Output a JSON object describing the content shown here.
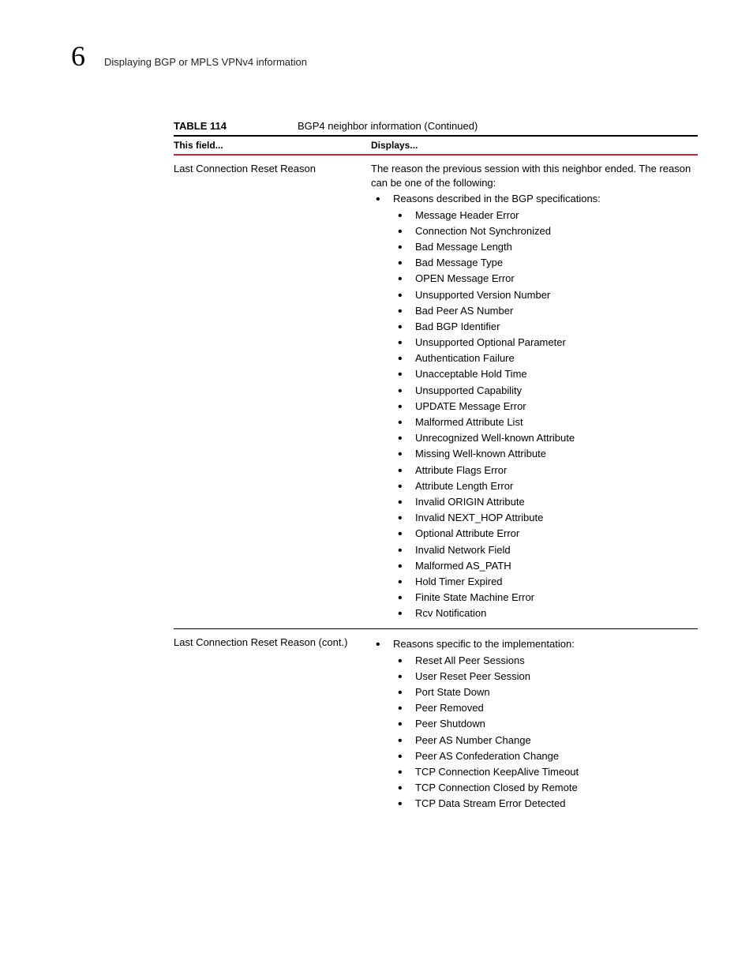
{
  "header": {
    "chapter": "6",
    "running_title": "Displaying BGP or MPLS VPNv4 information"
  },
  "table": {
    "label": "TABLE 114",
    "title": "BGP4 neighbor information  (Continued)",
    "col_a": "This field...",
    "col_b": "Displays..."
  },
  "rows": [
    {
      "field": "Last Connection Reset Reason",
      "intro": "The reason the previous session with this neighbor ended. The reason can be one of the following:",
      "level1": [
        {
          "text": "Reasons described in the BGP specifications:",
          "level2": [
            "Message Header Error",
            "Connection Not Synchronized",
            "Bad Message Length",
            "Bad Message Type",
            "OPEN Message Error",
            "Unsupported Version Number",
            "Bad Peer AS Number",
            "Bad BGP Identifier",
            "Unsupported Optional Parameter",
            "Authentication Failure",
            "Unacceptable Hold Time",
            "Unsupported Capability",
            "UPDATE Message Error",
            "Malformed Attribute List",
            "Unrecognized Well-known Attribute",
            "Missing Well-known Attribute",
            "Attribute Flags Error",
            "Attribute Length Error",
            "Invalid ORIGIN Attribute",
            "Invalid NEXT_HOP Attribute",
            "Optional Attribute Error",
            "Invalid Network Field",
            "Malformed AS_PATH",
            "Hold Timer Expired",
            "Finite State Machine Error",
            "Rcv Notification"
          ]
        }
      ]
    },
    {
      "field": "Last Connection Reset Reason (cont.)",
      "intro": "",
      "level1": [
        {
          "text": "Reasons specific to the implementation:",
          "level2": [
            "Reset All Peer Sessions",
            "User Reset Peer Session",
            "Port State Down",
            "Peer Removed",
            "Peer Shutdown",
            "Peer AS Number Change",
            "Peer AS Confederation Change",
            "TCP Connection KeepAlive Timeout",
            "TCP Connection Closed by Remote",
            "TCP Data Stream Error Detected"
          ]
        }
      ]
    }
  ]
}
